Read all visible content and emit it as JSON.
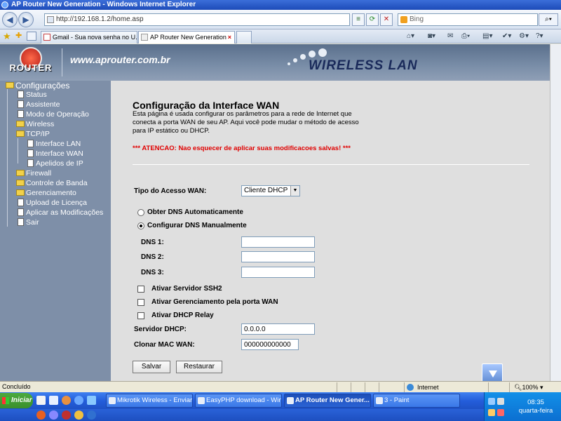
{
  "window": {
    "title": "AP Router New Generation - Windows Internet Explorer"
  },
  "browser": {
    "url": "http://192.168.1.2/home.asp",
    "search_placeholder": "Bing",
    "tabs": [
      {
        "label": "Gmail - Sua nova senha no U..."
      },
      {
        "label": "AP Router New Generation"
      }
    ]
  },
  "header": {
    "logo_text": "ROUTER",
    "site": "www.aprouter.com.br",
    "banner": "WIRELESS LAN"
  },
  "sidebar": {
    "root": "Configurações",
    "items": [
      {
        "label": "Status"
      },
      {
        "label": "Assistente"
      },
      {
        "label": "Modo de Operação"
      },
      {
        "label": "Wireless"
      },
      {
        "label": "TCP/IP"
      },
      {
        "label": "Interface LAN"
      },
      {
        "label": "Interface WAN"
      },
      {
        "label": "Apelidos de IP"
      },
      {
        "label": "Firewall"
      },
      {
        "label": "Controle de Banda"
      },
      {
        "label": "Gerenciamento"
      },
      {
        "label": "Upload de Licença"
      },
      {
        "label": "Aplicar as Modificações"
      },
      {
        "label": "Sair"
      }
    ]
  },
  "main": {
    "title": "Configuração da Interface WAN",
    "description": "Esta página é usada configurar os parâmetros para a rede de Internet que conecta a porta WAN de seu AP. Aqui você pode mudar o método de acesso para IP estático ou DHCP.",
    "warning": "*** ATENCAO: Nao esquecer de aplicar suas modificacoes salvas! ***",
    "wan_type_label": "Tipo do Acesso WAN:",
    "wan_type_value": "Cliente DHCP",
    "dns_auto": "Obter DNS Automaticamente",
    "dns_manual": "Configurar DNS Manualmente",
    "dns1_label": "DNS 1:",
    "dns2_label": "DNS 2:",
    "dns3_label": "DNS 3:",
    "ssh_label": "Ativar Servidor SSH2",
    "wan_mgmt_label": "Ativar Gerenciamento pela porta WAN",
    "dhcp_relay_label": "Ativar DHCP Relay",
    "dhcp_server_label": "Servidor DHCP:",
    "dhcp_server_value": "0.0.0.0",
    "clone_mac_label": "Clonar MAC WAN:",
    "clone_mac_value": "000000000000",
    "save_label": "Salvar",
    "reset_label": "Restaurar"
  },
  "status": {
    "text": "Concluído",
    "zone": "Internet",
    "zoom": "100%"
  },
  "taskbar": {
    "start": "Iniciar",
    "tasks": [
      {
        "label": "Mikrotik Wireless - Enviar..."
      },
      {
        "label": "EasyPHP download - Win..."
      },
      {
        "label": "AP Router New Gener..."
      },
      {
        "label": "3 - Paint"
      }
    ],
    "time": "08:35",
    "day": "quarta-feira"
  }
}
